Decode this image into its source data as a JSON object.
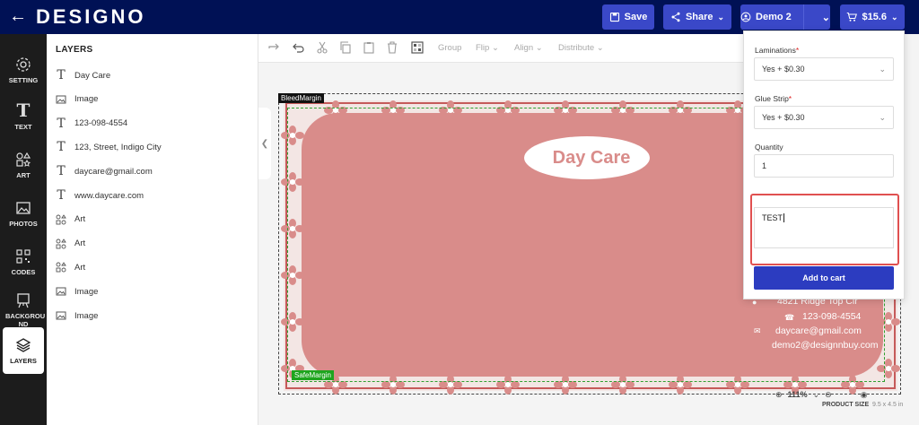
{
  "header": {
    "logo": "DESIGNO",
    "save_label": "Save",
    "share_label": "Share",
    "account_label": "Demo 2",
    "cart_label": "$15.6"
  },
  "rail": [
    {
      "label": "SETTING",
      "icon": "gear-icon"
    },
    {
      "label": "TEXT",
      "icon": "text-icon"
    },
    {
      "label": "ART",
      "icon": "shapes-icon"
    },
    {
      "label": "PHOTOS",
      "icon": "image-icon"
    },
    {
      "label": "CODES",
      "icon": "qr-code-icon"
    },
    {
      "label": "BACKGROU ND",
      "icon": "easel-icon"
    },
    {
      "label": "LAYERS",
      "icon": "layers-icon"
    }
  ],
  "layers": {
    "title": "LAYERS",
    "items": [
      {
        "label": "Day Care",
        "icon": "text-icon"
      },
      {
        "label": "Image",
        "icon": "image-icon"
      },
      {
        "label": "123-098-4554",
        "icon": "text-icon"
      },
      {
        "label": "123, Street, Indigo City",
        "icon": "text-icon"
      },
      {
        "label": "daycare@gmail.com",
        "icon": "text-icon"
      },
      {
        "label": "www.daycare.com",
        "icon": "text-icon"
      },
      {
        "label": "Art",
        "icon": "shapes-icon"
      },
      {
        "label": "Art",
        "icon": "shapes-icon"
      },
      {
        "label": "Art",
        "icon": "shapes-icon"
      },
      {
        "label": "Image",
        "icon": "image-icon"
      },
      {
        "label": "Image",
        "icon": "image-icon"
      }
    ]
  },
  "toolbar": {
    "group": "Group",
    "flip": "Flip",
    "align": "Align",
    "distribute": "Distribute"
  },
  "canvas": {
    "bleed_label": "BleedMargin",
    "safe_label": "SafeMargin",
    "logo_text": "Day Care",
    "address": "4821 Ridge Top Cir",
    "phone": "123-098-4554",
    "email1": "daycare@gmail.com",
    "email2": "demo2@designnbuy.com",
    "zoom": "111%",
    "product_size_label": "PRODUCT SIZE",
    "product_size_value": "9.5 x 4.5 in"
  },
  "cart_panel": {
    "laminations_label": "Laminations",
    "laminations_value": "Yes + $0.30",
    "glue_label": "Glue Strip",
    "glue_value": "Yes + $0.30",
    "quantity_label": "Quantity",
    "quantity_value": "1",
    "note_value": "TEST",
    "add_to_cart": "Add to cart"
  },
  "colors": {
    "header_bg": "#001155",
    "button": "#3a48c8",
    "card_pink": "#d98c8a",
    "highlight": "#e05050"
  }
}
